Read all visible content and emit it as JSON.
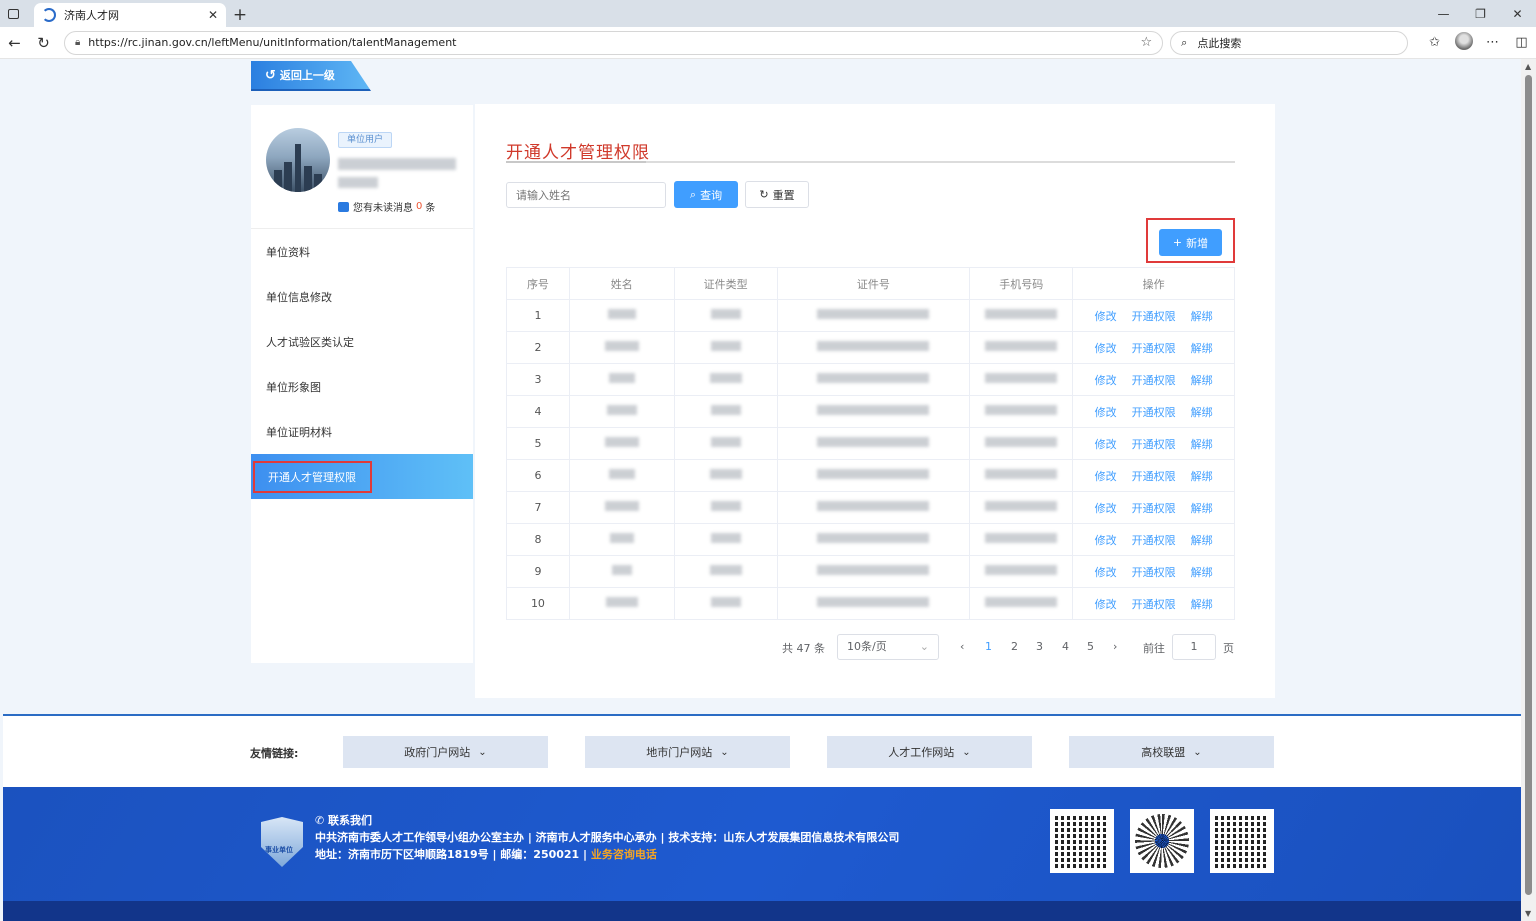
{
  "browser": {
    "tab_title": "济南人才网",
    "tab_close": "✕",
    "new_tab": "+",
    "url": "https://rc.jinan.gov.cn/leftMenu/unitInformation/talentManagement",
    "search_text": "点此搜索",
    "win_min": "—",
    "win_max": "❐",
    "win_close": "✕"
  },
  "page": {
    "back_label": "返回上一级",
    "profile": {
      "role_badge": "单位用户",
      "msg_prefix": "您有未读消息",
      "msg_count": "0",
      "msg_suffix": "条"
    },
    "menu": [
      {
        "label": "单位资料"
      },
      {
        "label": "单位信息修改"
      },
      {
        "label": "人才试验区类认定"
      },
      {
        "label": "单位形象图"
      },
      {
        "label": "单位证明材料"
      },
      {
        "label": "开通人才管理权限"
      }
    ],
    "title": "开通人才管理权限",
    "search": {
      "placeholder": "请输入姓名",
      "query_label": "查询",
      "reset_label": "重置",
      "add_label": "新增"
    },
    "table": {
      "headers": [
        "序号",
        "姓名",
        "证件类型",
        "证件号",
        "手机号码",
        "操作"
      ],
      "rows": [
        {
          "index": "1"
        },
        {
          "index": "2"
        },
        {
          "index": "3"
        },
        {
          "index": "4"
        },
        {
          "index": "5"
        },
        {
          "index": "6"
        },
        {
          "index": "7"
        },
        {
          "index": "8"
        },
        {
          "index": "9"
        },
        {
          "index": "10"
        }
      ],
      "op_edit": "修改",
      "op_grant": "开通权限",
      "op_unbind": "解绑"
    },
    "pagination": {
      "total": "共 47 条",
      "page_size": "10条/页",
      "pages": [
        "1",
        "2",
        "3",
        "4",
        "5"
      ],
      "current": "1",
      "goto_label": "前往",
      "goto_value": "1",
      "page_suffix": "页"
    }
  },
  "footer": {
    "links_label": "友情链接:",
    "links": [
      "政府门户网站",
      "地市门户网站",
      "人才工作网站",
      "高校联盟"
    ],
    "contact_title": "联系我们",
    "line1": "中共济南市委人才工作领导小组办公室主办 | 济南市人才服务中心承办 | 技术支持：山东人才发展集团信息技术有限公司",
    "line2": "地址：济南市历下区坤顺路1819号 | 邮编：250021 | ",
    "hotline": "业务咨询电话",
    "emblem_text": "事业单位"
  }
}
